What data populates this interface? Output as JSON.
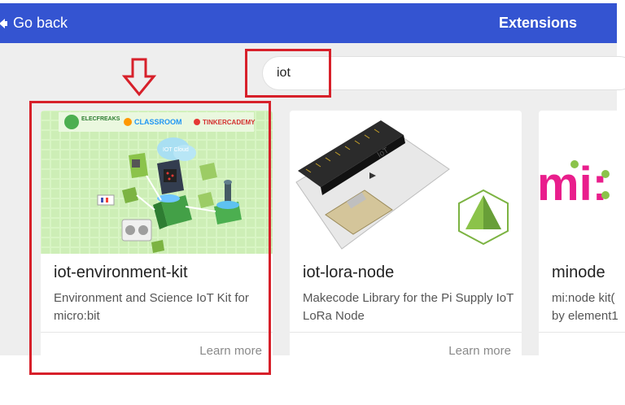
{
  "header": {
    "back_label": "Go back",
    "title": "Extensions",
    "bg_color": "#3454d1"
  },
  "search": {
    "value": "iot"
  },
  "cards": [
    {
      "name": "iot-environment-kit",
      "description": "Environment and Science IoT Kit for micro:bit",
      "learn_more": "Learn more",
      "logos": [
        "ELECFREAKS",
        "CLASSROOM",
        "TINKERCADEMY"
      ],
      "cloud_label": "IOT Cloud"
    },
    {
      "name": "iot-lora-node",
      "description": "Makecode Library for the Pi Supply IoT LoRa Node",
      "learn_more": "Learn more",
      "board_label": "IoT"
    },
    {
      "name": "minode",
      "description": "mi:node kit(",
      "description2": "by element1",
      "learn_more": "",
      "logo_text": "mi:"
    }
  ],
  "annotation_color": "#d7202a"
}
